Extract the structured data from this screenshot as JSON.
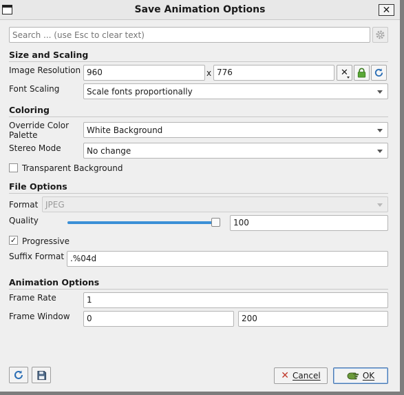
{
  "window": {
    "title": "Save Animation Options"
  },
  "search": {
    "placeholder": "Search ... (use Esc to clear text)",
    "value": ""
  },
  "size_scaling": {
    "header": "Size and Scaling",
    "resolution_label": "Image Resolution",
    "width": "960",
    "separator": "x",
    "height": "776",
    "font_scaling_label": "Font Scaling",
    "font_scaling_value": "Scale fonts proportionally"
  },
  "coloring": {
    "header": "Coloring",
    "palette_label": "Override Color Palette",
    "palette_value": "White Background",
    "stereo_label": "Stereo Mode",
    "stereo_value": "No change",
    "transparent_label": "Transparent Background",
    "transparent_checked": false
  },
  "file_options": {
    "header": "File Options",
    "format_label": "Format",
    "format_value": "JPEG",
    "format_enabled": false,
    "quality_label": "Quality",
    "quality_value": "100",
    "quality_fraction": 1.0,
    "progressive_label": "Progressive",
    "progressive_checked": true,
    "progressive_mark": "✓",
    "suffix_label": "Suffix Format",
    "suffix_value": ".%04d"
  },
  "animation": {
    "header": "Animation Options",
    "frame_rate_label": "Frame Rate",
    "frame_rate_value": "1",
    "frame_window_label": "Frame Window",
    "frame_window_start": "0",
    "frame_window_end": "200"
  },
  "buttons": {
    "cancel_label": "Cancel",
    "ok_label": "OK"
  },
  "colors": {
    "accent": "#3a8fd6",
    "lock_green": "#4a9a2c",
    "refresh_blue": "#2c6fb5"
  }
}
